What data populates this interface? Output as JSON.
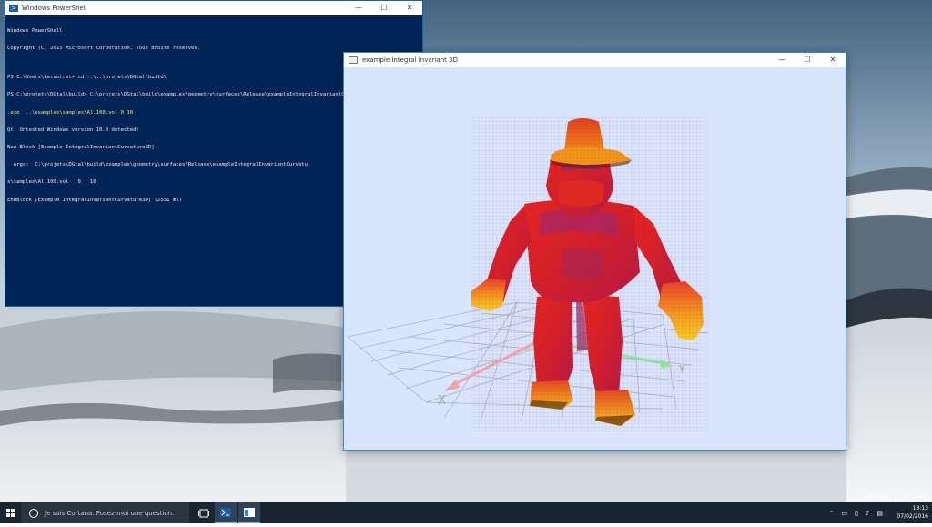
{
  "desktop": {
    "edition_label": "Windows 10 Éducation"
  },
  "powershell": {
    "title": "Windows PowerShell",
    "lines": [
      {
        "text": "Windows PowerShell",
        "color": "#eaeaea"
      },
      {
        "text": "Copyright (C) 2015 Microsoft Corporation. Tous droits réservés.",
        "color": "#eaeaea"
      },
      {
        "text": "",
        "color": "#eaeaea"
      },
      {
        "text": "PS C:\\Users\\kerautret> cd ..\\..\\projets\\DGtal\\build\\",
        "color": "#eaeaea"
      },
      {
        "text": "PS C:\\projets\\DGtal\\build> C:\\projets\\DGtal\\build\\examples\\geometry\\surfaces\\Release\\exampleIntegralInvariantCurvature3D",
        "color": "#eaeaea"
      },
      {
        "text": ".exe  ..\\examples\\samples\\Al.100.vol 0 10",
        "color": "#f5e56a"
      },
      {
        "text": "Qt: Untested Windows version 10.0 detected!",
        "color": "#eaeaea"
      },
      {
        "text": "New Block [Example IntegralInvariantCurvature3D]",
        "color": "#eaeaea"
      },
      {
        "text": "  Args:  C:\\projets\\DGtal\\build\\examples\\geometry\\surfaces\\Release\\exampleIntegralInvariantCurvatu",
        "color": "#eaeaea"
      },
      {
        "text": "s\\samples\\Al.100.vol   0   10",
        "color": "#eaeaea"
      },
      {
        "text": "EndBlock [Example IntegralInvariantCurvature3D] (2531 ms)",
        "color": "#eaeaea"
      }
    ]
  },
  "viewer": {
    "title": "example Integral Invariant 3D",
    "axis_labels": {
      "x": "X",
      "y": "Y"
    }
  },
  "taskbar": {
    "search_placeholder": "Je suis Cortana. Posez-moi une question.",
    "clock_time": "18:13",
    "clock_date": "07/02/2016",
    "tray_chevron": "⌃"
  },
  "window_controls": {
    "minimize": "—",
    "maximize": "☐",
    "close": "✕"
  },
  "colors": {
    "powershell_bg": "#012456",
    "viewer_bg": "#d9e4fd",
    "taskbar_bg": "#1a2532",
    "accent": "#2a8dd4"
  }
}
